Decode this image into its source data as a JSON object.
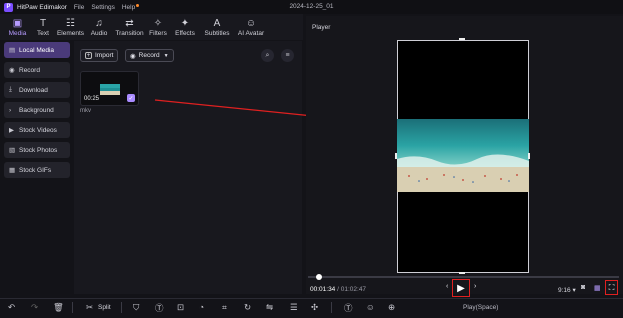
{
  "app": {
    "name": "HitPaw Edimakor",
    "logo_letter": "P",
    "menu": [
      "File",
      "Settings",
      "Help"
    ],
    "project_title": "2024-12-25_01"
  },
  "toolbar": [
    {
      "icon": "media-icon",
      "glyph": "▣",
      "label": "Media",
      "active": true
    },
    {
      "icon": "text-icon",
      "glyph": "T",
      "label": "Text"
    },
    {
      "icon": "elements-icon",
      "glyph": "☷",
      "label": "Elements"
    },
    {
      "icon": "audio-icon",
      "glyph": "♫",
      "label": "Audio"
    },
    {
      "icon": "transition-icon",
      "glyph": "⇄",
      "label": "Transition"
    },
    {
      "icon": "filters-icon",
      "glyph": "✧",
      "label": "Filters"
    },
    {
      "icon": "effects-icon",
      "glyph": "✦",
      "label": "Effects"
    },
    {
      "icon": "subtitles-icon",
      "glyph": "A",
      "label": "Subtitles"
    },
    {
      "icon": "ai-avatar-icon",
      "glyph": "☺",
      "label": "AI Avatar"
    }
  ],
  "sidebar": [
    {
      "icon": "folder-icon",
      "glyph": "▤",
      "label": "Local Media",
      "active": true
    },
    {
      "icon": "record-icon",
      "glyph": "◉",
      "label": "Record"
    },
    {
      "icon": "download-icon",
      "glyph": "⤓",
      "label": "Download"
    },
    {
      "icon": "chevron-right-icon",
      "glyph": "›",
      "label": "Background"
    },
    {
      "icon": "stock-videos-icon",
      "glyph": "▶",
      "label": "Stock Videos"
    },
    {
      "icon": "stock-photos-icon",
      "glyph": "▧",
      "label": "Stock Photos"
    },
    {
      "icon": "stock-gifs-icon",
      "glyph": "▦",
      "label": "Stock GIFs"
    }
  ],
  "media": {
    "import_label": "Import",
    "record_label": "Record",
    "clip_duration": "00:25",
    "clip_name": "mkv"
  },
  "player": {
    "title": "Player",
    "current_time": "00:01:34",
    "total_time": "01:02:47",
    "aspect_ratio": "9:16",
    "progress_fraction": 0.02
  },
  "bottom": {
    "split_label": "Split",
    "status": "Play(Space)"
  },
  "colors": {
    "accent": "#a98bff",
    "highlight": "#e02020",
    "ocean": "#1e8f94",
    "sand": "#d9cfb2"
  }
}
